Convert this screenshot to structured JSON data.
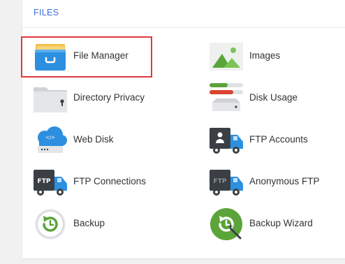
{
  "section": {
    "title": "FILES"
  },
  "items": [
    {
      "label": "File Manager",
      "icon": "file-manager-icon"
    },
    {
      "label": "Images",
      "icon": "images-icon"
    },
    {
      "label": "Directory Privacy",
      "icon": "directory-privacy-icon"
    },
    {
      "label": "Disk Usage",
      "icon": "disk-usage-icon"
    },
    {
      "label": "Web Disk",
      "icon": "web-disk-icon"
    },
    {
      "label": "FTP Accounts",
      "icon": "ftp-accounts-icon"
    },
    {
      "label": "FTP Connections",
      "icon": "ftp-connections-icon"
    },
    {
      "label": "Anonymous FTP",
      "icon": "anonymous-ftp-icon"
    },
    {
      "label": "Backup",
      "icon": "backup-icon"
    },
    {
      "label": "Backup Wizard",
      "icon": "backup-wizard-icon"
    }
  ],
  "colors": {
    "section_title": "#3f6ed8",
    "highlight_border": "#e03a3a",
    "green": "#5aa43a",
    "dark_icon": "#3a3f45",
    "blue_icon": "#2d8fe0",
    "red_bar": "#d9452f"
  }
}
